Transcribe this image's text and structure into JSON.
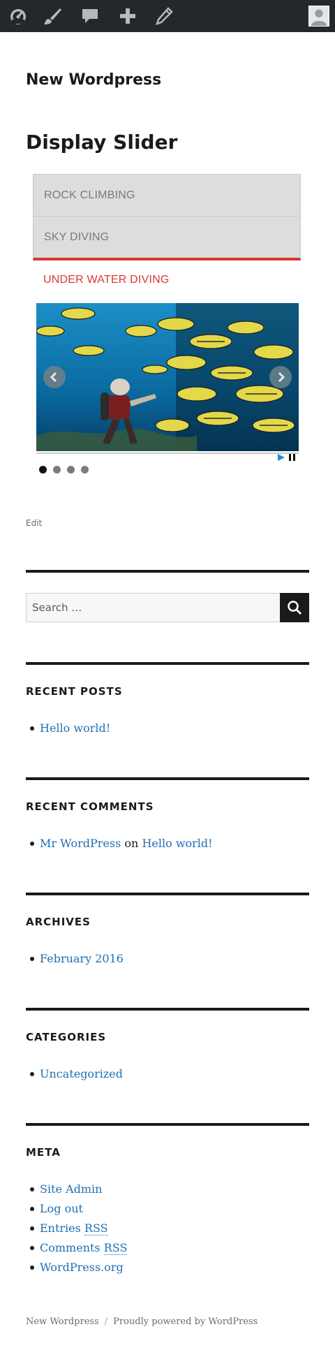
{
  "admin_bar": {
    "icons": [
      "dashboard-icon",
      "customize-brush-icon",
      "comments-icon",
      "new-content-plus-icon",
      "edit-pencil-icon"
    ],
    "avatar": "user-avatar"
  },
  "site": {
    "title": "New Wordpress"
  },
  "page": {
    "title": "Display Slider",
    "edit_label": "Edit"
  },
  "slider": {
    "tabs": [
      "ROCK CLIMBING",
      "SKY DIVING",
      "UNDER WATER DIVING"
    ],
    "active_tab": "UNDER WATER DIVING",
    "active_color": "#d63a2f",
    "slide_count": 4,
    "active_slide": 1,
    "image": "diver-with-fish-school"
  },
  "search": {
    "placeholder": "Search …"
  },
  "widgets": {
    "recent_posts": {
      "title": "RECENT POSTS",
      "items": [
        "Hello world!"
      ]
    },
    "recent_comments": {
      "title": "RECENT COMMENTS",
      "author": "Mr WordPress",
      "connector": "on",
      "post": "Hello world!"
    },
    "archives": {
      "title": "ARCHIVES",
      "items": [
        "February 2016"
      ]
    },
    "categories": {
      "title": "CATEGORIES",
      "items": [
        "Uncategorized"
      ]
    },
    "meta": {
      "title": "META",
      "site_admin": "Site Admin",
      "log_out": "Log out",
      "entries_prefix": "Entries",
      "comments_prefix": "Comments",
      "rss": "RSS",
      "wordpress_org": "WordPress.org"
    }
  },
  "footer": {
    "site": "New Wordpress",
    "separator": "/",
    "powered": "Proudly powered by WordPress"
  },
  "colors": {
    "link": "#1f6fb2",
    "admin_bar": "#23282d",
    "text": "#1a1a1a"
  }
}
